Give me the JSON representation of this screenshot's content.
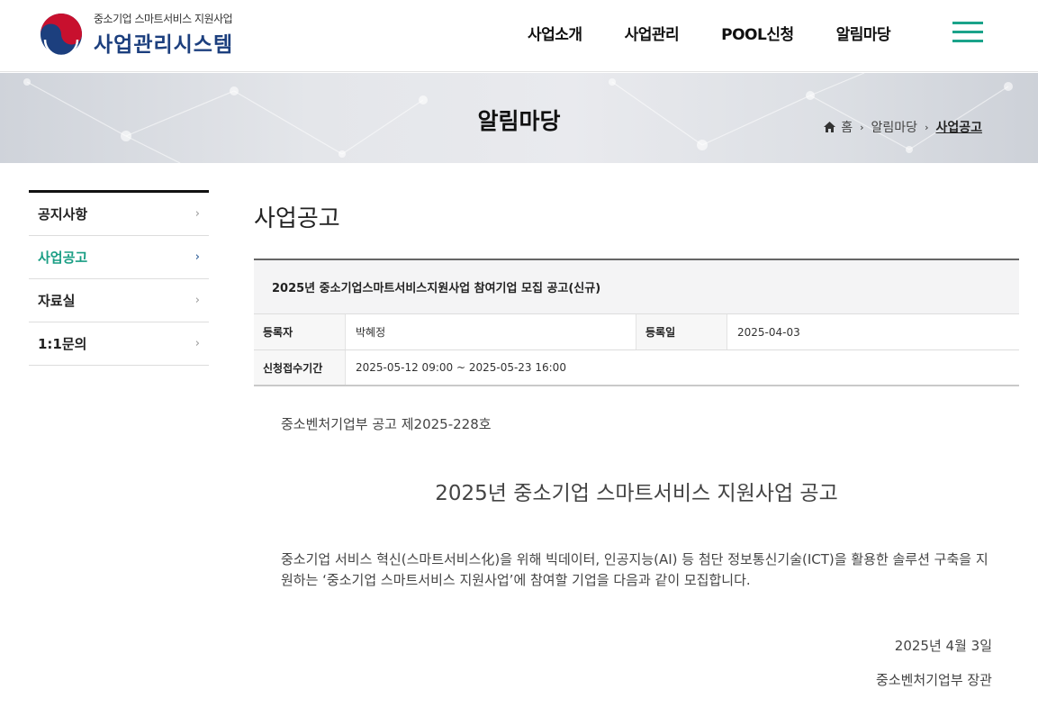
{
  "header": {
    "logo_sub": "중소기업 스마트서비스 지원사업",
    "logo_main": "사업관리시스템",
    "nav": [
      "사업소개",
      "사업관리",
      "POOL신청",
      "알림마당"
    ]
  },
  "banner": {
    "title": "알림마당",
    "breadcrumb": [
      "홈",
      "알림마당",
      "사업공고"
    ]
  },
  "sidebar": {
    "items": [
      {
        "label": "공지사항"
      },
      {
        "label": "사업공고"
      },
      {
        "label": "자료실"
      },
      {
        "label": "1:1문의"
      }
    ],
    "active_index": 1
  },
  "main": {
    "page_title": "사업공고",
    "post": {
      "title": "2025년 중소기업스마트서비스지원사업 참여기업 모집 공고(신규)",
      "author_label": "등록자",
      "author": "박혜정",
      "date_label": "등록일",
      "date": "2025-04-03",
      "period_label": "신청접수기간",
      "period": "2025-05-12 09:00 ~ 2025-05-23 16:00"
    },
    "doc": {
      "number": "중소벤처기업부 공고 제2025-228호",
      "heading": "2025년 중소기업 스마트서비스 지원사업 공고",
      "body": "중소기업 서비스 혁신(스마트서비스化)을 위해 빅데이터, 인공지능(AI) 등 첨단 정보통신기술(ICT)을 활용한 솔루션 구축을 지원하는 ‘중소기업 스마트서비스 지원사업’에 참여할 기업을 다음과 같이 모집합니다.",
      "date": "2025년 4월 3일",
      "signature": "중소벤처기업부 장관"
    }
  },
  "colors": {
    "accent": "#1aa38a",
    "brand_blue": "#1c3f7e",
    "brand_red": "#c8102e"
  },
  "icons": {
    "menu": "hamburger-icon",
    "home": "home-icon",
    "chevron": "chevron-right-icon"
  }
}
